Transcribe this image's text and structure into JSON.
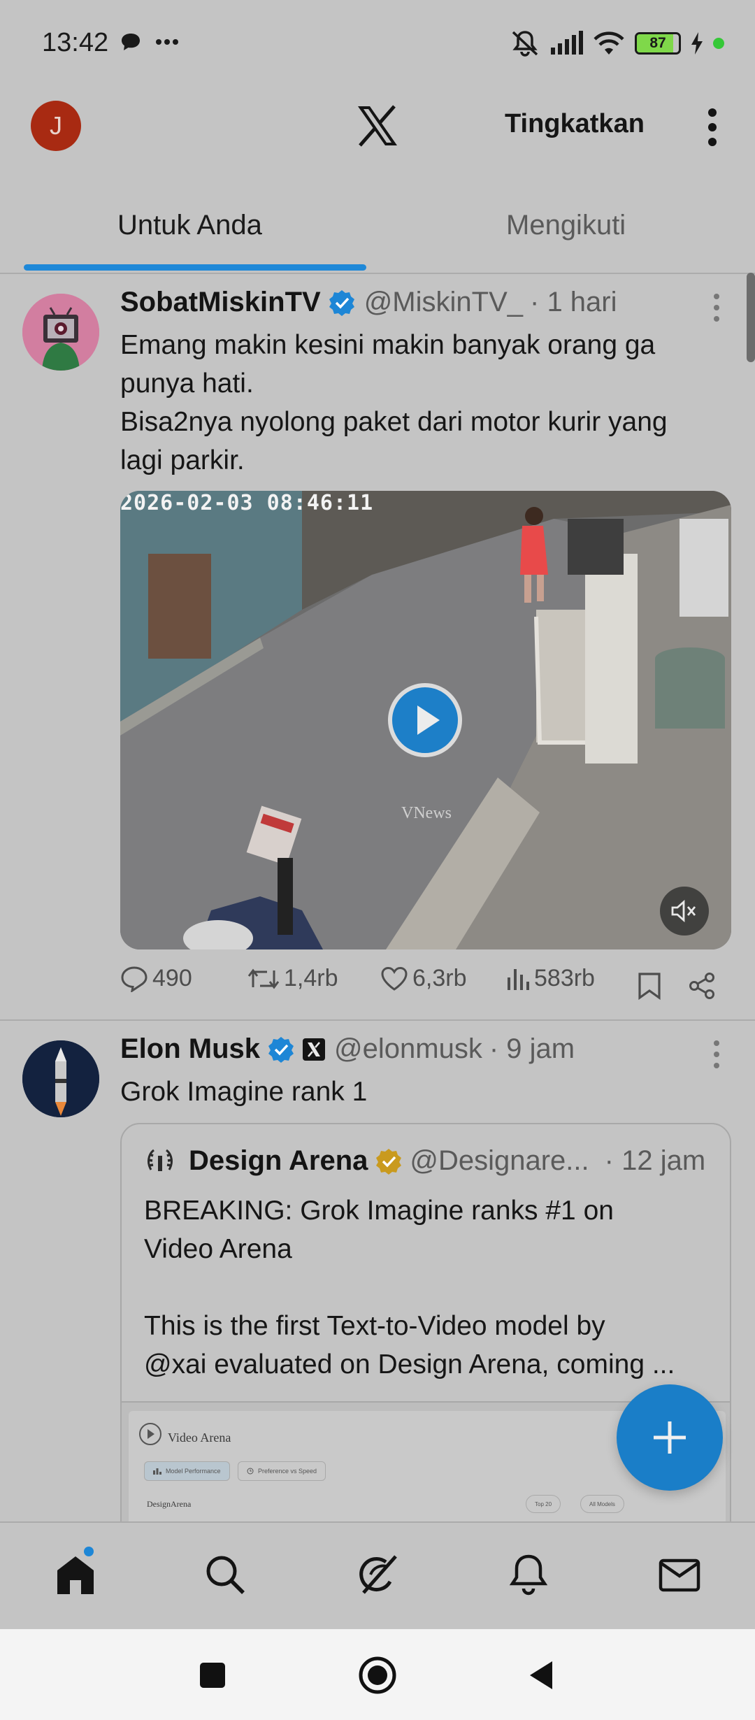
{
  "status_bar": {
    "time": "13:42",
    "battery_level": "87",
    "battery_fraction": 0.87,
    "icons": [
      "chat-bubble-icon",
      "more-dots-icon",
      "vibrate-off-icon",
      "signal-icon",
      "wifi-icon",
      "battery-icon",
      "charging-icon",
      "active-dot-icon"
    ]
  },
  "top_bar": {
    "avatar_initial": "J",
    "avatar_color": "#a82a12",
    "logo": "x-logo-icon",
    "upgrade_label": "Tingkatkan",
    "menu_icon": "more-vertical-icon"
  },
  "tabs": [
    {
      "label": "Untuk Anda",
      "active": true
    },
    {
      "label": "Mengikuti",
      "active": false
    }
  ],
  "accent_color": "#1d86d6",
  "posts": [
    {
      "name": "SobatMiskinTV",
      "verified": "blue",
      "handle": "@MiskinTV_",
      "time": "· 1 hari",
      "text_lines": [
        "Emang makin kesini makin banyak orang ga",
        "punya hati.",
        "Bisa2nya nyolong paket dari motor kurir yang",
        "lagi parkir."
      ],
      "media": {
        "type": "video",
        "timestamp_overlay": "2026-02-03 08:46:11",
        "watermark": "VNews",
        "muted": true
      },
      "stats": {
        "replies": "490",
        "reposts": "1,4rb",
        "likes": "6,3rb",
        "views": "583rb"
      }
    },
    {
      "name": "Elon Musk",
      "verified": "blue",
      "affiliate_badge": "x-badge-icon",
      "handle": "@elonmusk",
      "time": "· 9 jam",
      "text": "Grok Imagine rank 1",
      "quote": {
        "name": "Design Arena",
        "verified": "gold",
        "handle": "@Designare...",
        "time": "· 12 jam",
        "text_lines": [
          "BREAKING: Grok Imagine ranks #1 on",
          "Video Arena",
          "",
          "This is the first Text-to-Video model by",
          "@xai evaluated on Design Arena, coming ..."
        ],
        "image": {
          "title": "Video Arena",
          "tab_1": "Model Performance",
          "tab_2": "Preference vs Speed",
          "brand": "DesignArena",
          "select_1": "Top 20",
          "select_2": "All Models"
        }
      }
    }
  ],
  "fab": {
    "icon": "plus-icon"
  },
  "bottom_nav": [
    {
      "name": "home",
      "icon": "home-icon",
      "active": true,
      "badge": true
    },
    {
      "name": "search",
      "icon": "search-icon",
      "active": false
    },
    {
      "name": "grok",
      "icon": "grok-icon",
      "active": false
    },
    {
      "name": "notifications",
      "icon": "bell-icon",
      "active": false
    },
    {
      "name": "messages",
      "icon": "mail-icon",
      "active": false
    }
  ],
  "system_nav": [
    "recents-square-icon",
    "home-circle-icon",
    "back-triangle-icon"
  ]
}
